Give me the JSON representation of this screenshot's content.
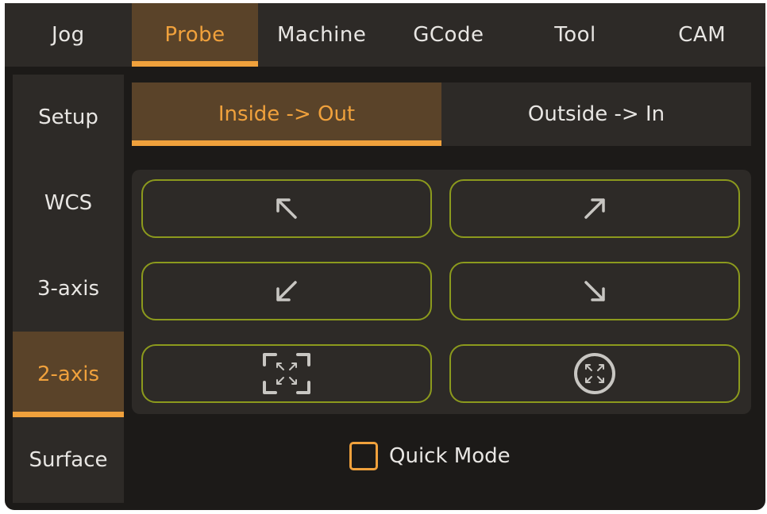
{
  "top_tabs": [
    {
      "label": "Jog",
      "active": false
    },
    {
      "label": "Probe",
      "active": true
    },
    {
      "label": "Machine",
      "active": false
    },
    {
      "label": "GCode",
      "active": false
    },
    {
      "label": "Tool",
      "active": false
    },
    {
      "label": "CAM",
      "active": false
    }
  ],
  "side_tabs": [
    {
      "label": "Setup",
      "active": false
    },
    {
      "label": "WCS",
      "active": false
    },
    {
      "label": "3-axis",
      "active": false
    },
    {
      "label": "2-axis",
      "active": true
    },
    {
      "label": "Surface",
      "active": false
    }
  ],
  "mode_tabs": [
    {
      "label": "Inside -> Out",
      "active": true
    },
    {
      "label": "Outside -> In",
      "active": false
    }
  ],
  "probe_buttons": [
    {
      "icon": "arrow-up-left-icon"
    },
    {
      "icon": "arrow-up-right-icon"
    },
    {
      "icon": "arrow-down-left-icon"
    },
    {
      "icon": "arrow-down-right-icon"
    },
    {
      "icon": "rectangle-pocket-icon"
    },
    {
      "icon": "circle-bore-icon"
    }
  ],
  "quick_mode": {
    "label": "Quick Mode",
    "checked": false
  },
  "colors": {
    "accent": "#f0a13c",
    "active_tab_bg": "#5a4329",
    "button_border": "#8c9a1d",
    "panel_bg": "#2d2a27",
    "window_bg": "#1c1a18",
    "icon_color": "#c8c6c2"
  }
}
